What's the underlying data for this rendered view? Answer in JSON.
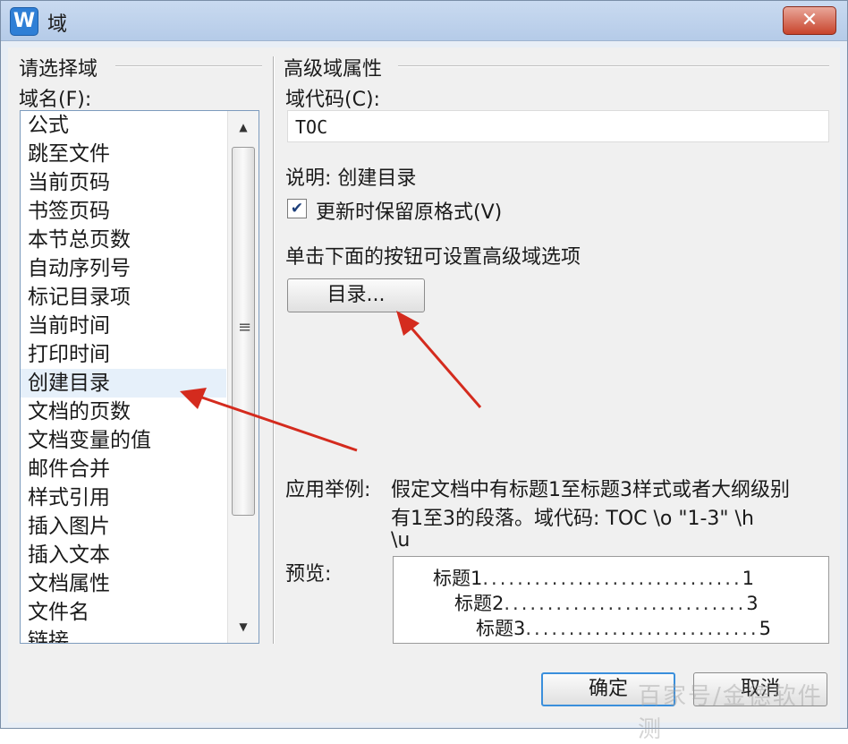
{
  "window": {
    "app_icon": "W",
    "title": "域",
    "close": "✕"
  },
  "left": {
    "group_title": "请选择域",
    "list_label": "域名(F):",
    "items": [
      "公式",
      "跳至文件",
      "当前页码",
      "书签页码",
      "本节总页数",
      "自动序列号",
      "标记目录项",
      "当前时间",
      "打印时间",
      "创建目录",
      "文档的页数",
      "文档变量的值",
      "邮件合并",
      "样式引用",
      "插入图片",
      "插入文本",
      "文档属性",
      "文件名",
      "链接"
    ],
    "selected": "创建目录"
  },
  "right": {
    "group_title": "高级域属性",
    "code_label": "域代码(C):",
    "code_value": "TOC",
    "description": "说明: 创建目录",
    "checkbox_label": "更新时保留原格式(V)",
    "checkbox_checked": true,
    "hint": "单击下面的按钮可设置高级域选项",
    "toc_button": "目录...",
    "example_label": "应用举例:",
    "example_line1": "假定文档中有标题1至标题3样式或者大纲级别",
    "example_line2": "有1至3的段落。域代码: TOC \\o \"1-3\" \\h",
    "example_line3": "\\u",
    "preview_label": "预览:",
    "preview": [
      {
        "title": "标题1",
        "page": "1"
      },
      {
        "title": "标题2",
        "page": "3"
      },
      {
        "title": "标题3",
        "page": "5"
      }
    ]
  },
  "buttons": {
    "ok": "确定",
    "cancel": "取消"
  },
  "annotation_color": "#d42b1e",
  "watermark": "百家号/金德软件测"
}
